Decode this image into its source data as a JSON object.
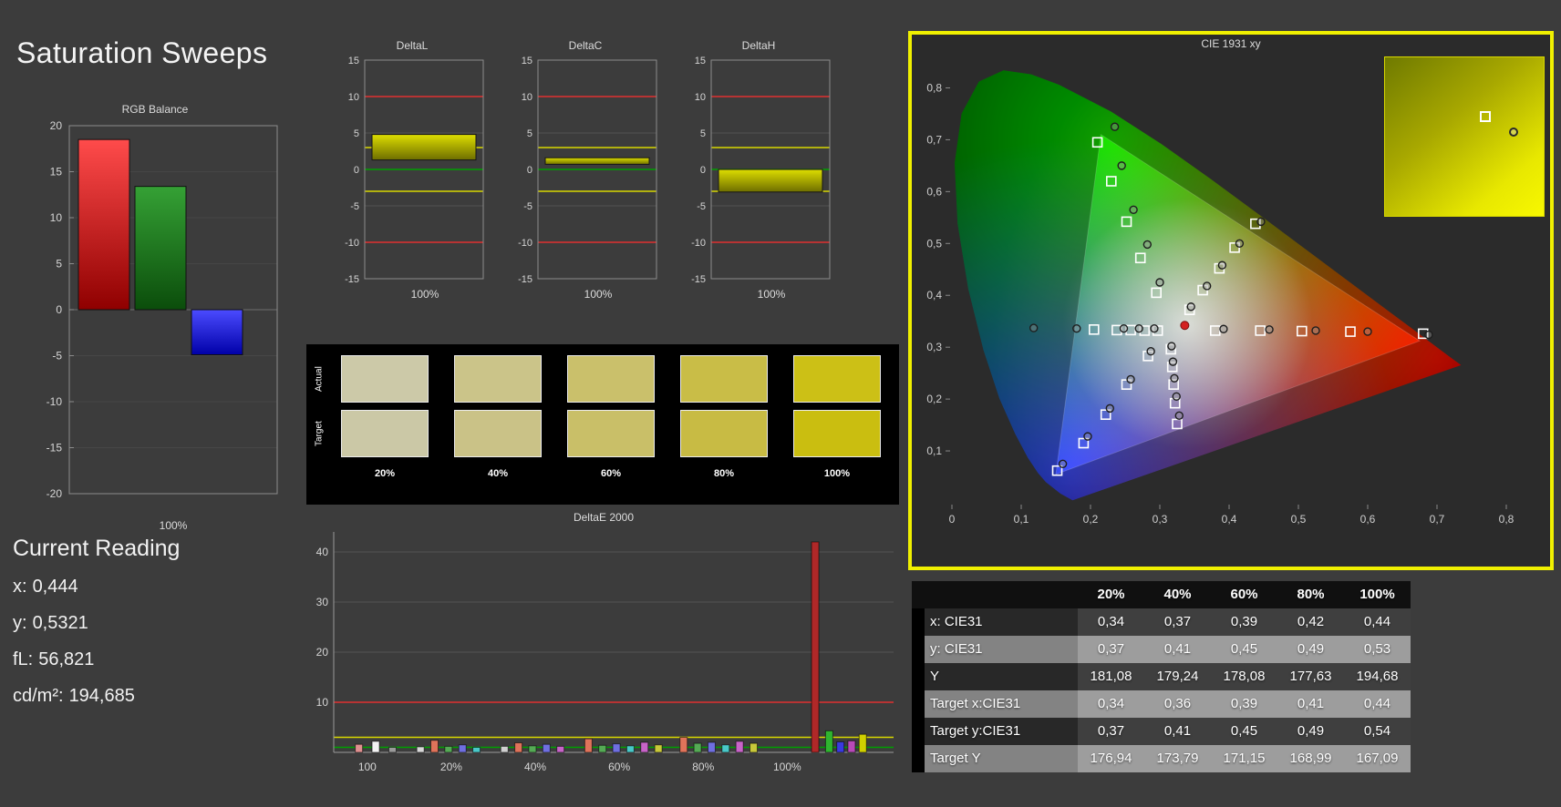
{
  "page": {
    "title": "Saturation Sweeps"
  },
  "current_reading": {
    "title": "Current Reading",
    "lines": [
      {
        "label": "x:",
        "value": "0,444"
      },
      {
        "label": "y:",
        "value": "0,5321"
      },
      {
        "label": "fL:",
        "value": "56,821"
      },
      {
        "label": "cd/m²:",
        "value": "194,685"
      }
    ]
  },
  "swatches": {
    "row_labels": [
      "Actual",
      "Target"
    ],
    "col_labels": [
      "20%",
      "40%",
      "60%",
      "80%",
      "100%"
    ],
    "rows": [
      [
        "#ccc9a8",
        "#cbc489",
        "#cac06b",
        "#c9bd47",
        "#ccc016"
      ],
      [
        "#cbc8a6",
        "#cac287",
        "#c9bf68",
        "#c8bb44",
        "#cabe10"
      ]
    ]
  },
  "chart_data": [
    {
      "id": "rgb_balance",
      "type": "bar",
      "title": "RGB Balance",
      "x_label": "100%",
      "ylim": [
        -20,
        20
      ],
      "yticks": [
        20,
        15,
        10,
        5,
        0,
        -5,
        -10,
        -15,
        -20
      ],
      "categories": [
        "Red",
        "Green",
        "Blue"
      ],
      "values": [
        18.5,
        13.4,
        -4.9
      ],
      "bar_colors": [
        [
          "#ff4b4b",
          "#8f0000"
        ],
        [
          "#35a135",
          "#0b4d0b"
        ],
        [
          "#4b4bff",
          "#0000a8"
        ]
      ]
    },
    {
      "id": "deltaL",
      "type": "bar",
      "title": "DeltaL",
      "x_label": "100%",
      "ylim": [
        -15,
        15
      ],
      "yticks": [
        15,
        10,
        5,
        0,
        -5,
        -10,
        -15
      ],
      "categories": [
        "100%"
      ],
      "values": [
        4.8
      ],
      "bar_span": [
        1.3,
        4.8
      ],
      "ref_lines": [
        {
          "y": 10,
          "color": "#e03030"
        },
        {
          "y": -10,
          "color": "#e03030"
        },
        {
          "y": 3,
          "color": "#d8d800"
        },
        {
          "y": -3,
          "color": "#d8d800"
        },
        {
          "y": 0,
          "color": "#00a000"
        }
      ]
    },
    {
      "id": "deltaC",
      "type": "bar",
      "title": "DeltaC",
      "x_label": "100%",
      "ylim": [
        -15,
        15
      ],
      "yticks": [
        15,
        10,
        5,
        0,
        -5,
        -10,
        -15
      ],
      "categories": [
        "100%"
      ],
      "values": [
        1.6
      ],
      "bar_span": [
        0.7,
        1.6
      ],
      "ref_lines": [
        {
          "y": 10,
          "color": "#e03030"
        },
        {
          "y": -10,
          "color": "#e03030"
        },
        {
          "y": 3,
          "color": "#d8d800"
        },
        {
          "y": -3,
          "color": "#d8d800"
        },
        {
          "y": 0,
          "color": "#00a000"
        }
      ]
    },
    {
      "id": "deltaH",
      "type": "bar",
      "title": "DeltaH",
      "x_label": "100%",
      "ylim": [
        -15,
        15
      ],
      "yticks": [
        15,
        10,
        5,
        0,
        -5,
        -10,
        -15
      ],
      "categories": [
        "100%"
      ],
      "values": [
        -3.1
      ],
      "bar_span": [
        -3.1,
        0.0
      ],
      "ref_lines": [
        {
          "y": 10,
          "color": "#e03030"
        },
        {
          "y": -10,
          "color": "#e03030"
        },
        {
          "y": 3,
          "color": "#d8d800"
        },
        {
          "y": -3,
          "color": "#d8d800"
        },
        {
          "y": 0,
          "color": "#00a000"
        }
      ]
    },
    {
      "id": "deltae2000",
      "type": "bar",
      "title": "DeltaE 2000",
      "ylim": [
        0,
        44
      ],
      "yticks": [
        10,
        20,
        30,
        40
      ],
      "ref_lines": [
        {
          "y": 10,
          "color": "#e03030"
        },
        {
          "y": 3,
          "color": "#d8d800"
        },
        {
          "y": 1,
          "color": "#00a000"
        }
      ],
      "x_tick_labels": [
        {
          "label": "100",
          "frac": 0.06
        },
        {
          "label": "20%",
          "frac": 0.21
        },
        {
          "label": "40%",
          "frac": 0.36
        },
        {
          "label": "60%",
          "frac": 0.51
        },
        {
          "label": "80%",
          "frac": 0.66
        },
        {
          "label": "100%",
          "frac": 0.81
        }
      ],
      "bars": [
        [
          0.045,
          1.6,
          "#e09090"
        ],
        [
          0.075,
          2.2,
          "#f2f2f2"
        ],
        [
          0.105,
          1.0,
          "#9a9a9a"
        ],
        [
          0.155,
          1.1,
          "#d8d8d8"
        ],
        [
          0.18,
          2.4,
          "#e0735a"
        ],
        [
          0.205,
          1.2,
          "#55aa55"
        ],
        [
          0.23,
          1.5,
          "#6f6fe0"
        ],
        [
          0.255,
          1.0,
          "#49c8c8"
        ],
        [
          0.305,
          1.2,
          "#d0d0d0"
        ],
        [
          0.33,
          1.9,
          "#e0735a"
        ],
        [
          0.355,
          1.3,
          "#55aa55"
        ],
        [
          0.38,
          1.6,
          "#6f6fe0"
        ],
        [
          0.405,
          1.2,
          "#c864c8"
        ],
        [
          0.455,
          2.7,
          "#e0735a"
        ],
        [
          0.48,
          1.4,
          "#55aa55"
        ],
        [
          0.505,
          1.7,
          "#6f6fe0"
        ],
        [
          0.53,
          1.3,
          "#49c8c8"
        ],
        [
          0.555,
          2.0,
          "#c864c8"
        ],
        [
          0.58,
          1.5,
          "#c8c83a"
        ],
        [
          0.625,
          3.0,
          "#e0735a"
        ],
        [
          0.65,
          1.8,
          "#55aa55"
        ],
        [
          0.675,
          2.0,
          "#6f6fe0"
        ],
        [
          0.7,
          1.5,
          "#49c8c8"
        ],
        [
          0.725,
          2.2,
          "#c864c8"
        ],
        [
          0.75,
          1.8,
          "#c8c83a"
        ],
        [
          0.86,
          42.0,
          "#b02828"
        ],
        [
          0.885,
          4.3,
          "#2fb42f"
        ],
        [
          0.905,
          2.1,
          "#3a3ae0"
        ],
        [
          0.925,
          2.3,
          "#b84ab8"
        ],
        [
          0.945,
          3.6,
          "#d0d000"
        ]
      ]
    },
    {
      "id": "cie",
      "type": "scatter",
      "title": "CIE 1931 xy",
      "xlim": [
        0,
        0.85
      ],
      "ylim": [
        0,
        0.85
      ],
      "xtick_labels": [
        "0",
        "0,1",
        "0,2",
        "0,3",
        "0,4",
        "0,5",
        "0,6",
        "0,7",
        "0,8"
      ],
      "ytick_labels": [
        "0,1",
        "0,2",
        "0,3",
        "0,4",
        "0,5",
        "0,6",
        "0,7",
        "0,8"
      ],
      "border_color": "#f0f000",
      "gamut_triangle": [
        [
          0.675,
          0.312
        ],
        [
          0.215,
          0.71
        ],
        [
          0.15,
          0.055
        ]
      ],
      "targets": [
        [
          0.38,
          0.332
        ],
        [
          0.445,
          0.332
        ],
        [
          0.505,
          0.331
        ],
        [
          0.575,
          0.33
        ],
        [
          0.68,
          0.326
        ],
        [
          0.295,
          0.405
        ],
        [
          0.272,
          0.472
        ],
        [
          0.252,
          0.542
        ],
        [
          0.23,
          0.62
        ],
        [
          0.21,
          0.695
        ],
        [
          0.283,
          0.283
        ],
        [
          0.252,
          0.228
        ],
        [
          0.222,
          0.17
        ],
        [
          0.19,
          0.115
        ],
        [
          0.152,
          0.062
        ],
        [
          0.297,
          0.332
        ],
        [
          0.278,
          0.332
        ],
        [
          0.258,
          0.333
        ],
        [
          0.238,
          0.333
        ],
        [
          0.205,
          0.334
        ],
        [
          0.316,
          0.296
        ],
        [
          0.318,
          0.262
        ],
        [
          0.32,
          0.228
        ],
        [
          0.322,
          0.192
        ],
        [
          0.325,
          0.152
        ],
        [
          0.343,
          0.372
        ],
        [
          0.362,
          0.41
        ],
        [
          0.386,
          0.452
        ],
        [
          0.408,
          0.492
        ],
        [
          0.438,
          0.538
        ]
      ],
      "measurements": [
        [
          0.392,
          0.335
        ],
        [
          0.458,
          0.334
        ],
        [
          0.525,
          0.332
        ],
        [
          0.6,
          0.33
        ],
        [
          0.688,
          0.324
        ],
        [
          0.3,
          0.425
        ],
        [
          0.282,
          0.498
        ],
        [
          0.262,
          0.565
        ],
        [
          0.245,
          0.65
        ],
        [
          0.235,
          0.725
        ],
        [
          0.287,
          0.292
        ],
        [
          0.258,
          0.238
        ],
        [
          0.228,
          0.182
        ],
        [
          0.196,
          0.128
        ],
        [
          0.16,
          0.075
        ],
        [
          0.292,
          0.336
        ],
        [
          0.27,
          0.336
        ],
        [
          0.248,
          0.336
        ],
        [
          0.18,
          0.336
        ],
        [
          0.118,
          0.337
        ],
        [
          0.317,
          0.302
        ],
        [
          0.319,
          0.272
        ],
        [
          0.321,
          0.24
        ],
        [
          0.324,
          0.205
        ],
        [
          0.328,
          0.168
        ],
        [
          0.345,
          0.378
        ],
        [
          0.368,
          0.418
        ],
        [
          0.39,
          0.458
        ],
        [
          0.415,
          0.5
        ],
        [
          0.446,
          0.542
        ]
      ],
      "current_point": [
        0.336,
        0.342
      ]
    },
    {
      "id": "measurement_table",
      "type": "table",
      "col_headers": [
        "20%",
        "40%",
        "60%",
        "80%",
        "100%"
      ],
      "rows": [
        {
          "label": "x: CIE31",
          "values": [
            "0,34",
            "0,37",
            "0,39",
            "0,42",
            "0,44"
          ]
        },
        {
          "label": "y: CIE31",
          "values": [
            "0,37",
            "0,41",
            "0,45",
            "0,49",
            "0,53"
          ]
        },
        {
          "label": "Y",
          "values": [
            "181,08",
            "179,24",
            "178,08",
            "177,63",
            "194,68"
          ]
        },
        {
          "label": "Target x:CIE31",
          "values": [
            "0,34",
            "0,36",
            "0,39",
            "0,41",
            "0,44"
          ]
        },
        {
          "label": "Target y:CIE31",
          "values": [
            "0,37",
            "0,41",
            "0,45",
            "0,49",
            "0,54"
          ]
        },
        {
          "label": "Target Y",
          "values": [
            "176,94",
            "173,79",
            "171,15",
            "168,99",
            "167,09"
          ]
        }
      ]
    }
  ]
}
